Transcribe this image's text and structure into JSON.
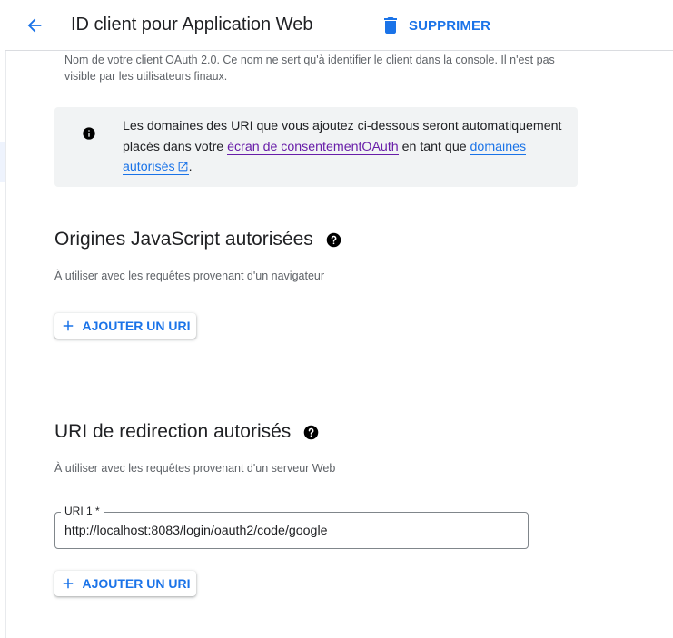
{
  "header": {
    "title": "ID client pour Application Web",
    "delete_label": "SUPPRIMER"
  },
  "name_help": "Nom de votre client OAuth 2.0. Ce nom ne sert qu'à identifier le client dans la console. Il n'est pas visible par les utilisateurs finaux.",
  "info": {
    "text_before": "Les domaines des URI que vous ajoutez ci-dessous seront automatiquement placés dans votre ",
    "consent_link": "écran de consentementOAuth",
    "text_middle": " en tant que ",
    "domains_link": "domaines autorisés",
    "text_after": "."
  },
  "js_origins": {
    "title": "Origines JavaScript autorisées",
    "subtitle": "À utiliser avec les requêtes provenant d'un navigateur",
    "add_label": "AJOUTER UN URI"
  },
  "redirect_uris": {
    "title": "URI de redirection autorisés",
    "subtitle": "À utiliser avec les requêtes provenant d'un serveur Web",
    "field_label": "URI 1 *",
    "field_value": "http://localhost:8083/login/oauth2/code/google",
    "add_label": "AJOUTER UN URI"
  },
  "icons": {
    "back": "arrow-back-icon",
    "delete": "trash-icon",
    "info": "info-icon",
    "help": "help-icon",
    "add": "plus-icon",
    "external": "external-link-icon"
  },
  "colors": {
    "accent": "#1a73e8",
    "visited_link": "#681da8",
    "info_bg": "#f1f3f4",
    "text": "#202124",
    "secondary_text": "#5f6368"
  }
}
